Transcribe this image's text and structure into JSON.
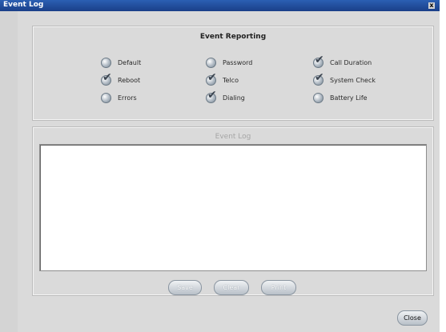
{
  "window": {
    "title": "Event Log",
    "close_glyph": "x"
  },
  "event_reporting": {
    "title": "Event Reporting",
    "options": [
      {
        "label": "Default",
        "checked": false
      },
      {
        "label": "Password",
        "checked": false
      },
      {
        "label": "Call Duration",
        "checked": true
      },
      {
        "label": "Reboot",
        "checked": true
      },
      {
        "label": "Telco",
        "checked": true
      },
      {
        "label": "System Check",
        "checked": true
      },
      {
        "label": "Errors",
        "checked": false
      },
      {
        "label": "Dialing",
        "checked": true
      },
      {
        "label": "Battery Life",
        "checked": false
      }
    ]
  },
  "event_log": {
    "title": "Event Log",
    "content": ""
  },
  "buttons": {
    "save": "Save",
    "clear": "Clear",
    "print": "Print",
    "close": "Close"
  }
}
